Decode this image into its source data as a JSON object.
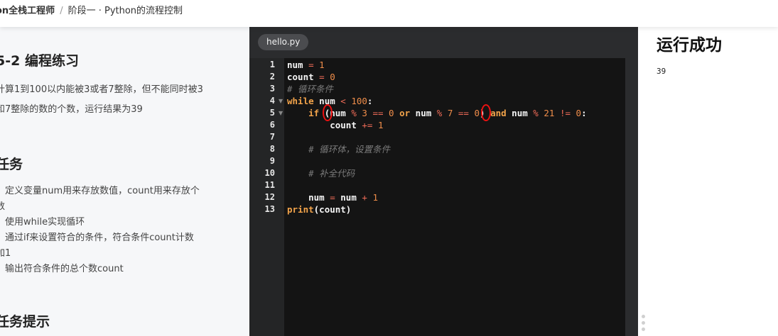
{
  "breadcrumb": {
    "course": "on全栈工程师",
    "separator": "/",
    "stage": "阶段一 · Python的流程控制"
  },
  "task": {
    "title": "5-2 编程练习",
    "desc_line1": "计算1到100以内能被3或者7整除，但不能同时被3",
    "desc_line2": "和7整除的数的个数，运行结果为39",
    "section_tasks": "任务",
    "items": [
      "、定义变量num用来存放数值，count用来存放个",
      "数",
      "、使用while实现循环",
      "、通过if来设置符合的条件，符合条件count计数",
      "加1",
      "、输出符合条件的总个数count"
    ],
    "section_hints": "任务提示"
  },
  "editor": {
    "tab": "hello.py",
    "line_numbers": [
      "1",
      "2",
      "3",
      "4",
      "5",
      "6",
      "7",
      "8",
      "9",
      "10",
      "11",
      "12",
      "13"
    ],
    "code": {
      "l1_var": "num",
      "l1_op": " = ",
      "l1_val": "1",
      "l2_var": "count",
      "l2_op": " = ",
      "l2_val": "0",
      "l3_comment": "# 循环条件",
      "l4_kw": "while",
      "l4_var": " num ",
      "l4_op": "<",
      "l4_val": " 100",
      "l4_end": ":",
      "l5_indent": "    ",
      "l5_kw": "if",
      "l5_a": " (num ",
      "l5_op1": "%",
      "l5_n1": " 3 ",
      "l5_op2": "==",
      "l5_n2": " 0 ",
      "l5_or": "or",
      "l5_b": " num ",
      "l5_op3": "%",
      "l5_n3": " 7 ",
      "l5_op4": "==",
      "l5_n4": " 0",
      "l5_c": ") ",
      "l5_and": "and",
      "l5_d": " num ",
      "l5_op5": "%",
      "l5_n5": " 21 ",
      "l5_op6": "!=",
      "l5_n6": " 0",
      "l5_end": ":",
      "l6_indent": "        ",
      "l6_var": "count ",
      "l6_op": "+=",
      "l6_val": " 1",
      "l8_indent": "    ",
      "l8_comment": "# 循环体，设置条件",
      "l10_indent": "    ",
      "l10_comment": "# 补全代码",
      "l12_indent": "    ",
      "l12_a": "num ",
      "l12_op1": "=",
      "l12_b": " num ",
      "l12_op2": "+",
      "l12_val": " 1",
      "l13_fn": "print",
      "l13_rest": "(count)"
    }
  },
  "output": {
    "title": "运行成功",
    "result": "39"
  },
  "colors": {
    "editor_bg": "#141414",
    "keyword": "#f2a34a",
    "number": "#ef8d4a",
    "comment": "#7a7a7a",
    "annotation_mark": "#ee1111"
  }
}
